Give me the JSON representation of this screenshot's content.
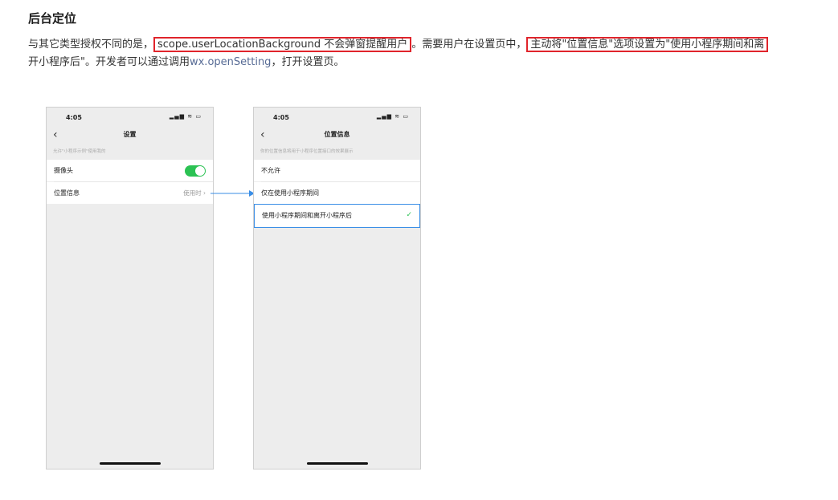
{
  "title": "后台定位",
  "para": {
    "t1": "与其它类型授权不同的是，",
    "hl1": "scope.userLocationBackground 不会弹窗提醒用户",
    "t2": "。需要用户在设置页中，",
    "hl2": "主动将\"位置信息\"选项设置为\"使用小程序期间和离",
    "t3": "开小程序后\"。开发者可以通过调用",
    "link": "wx.openSetting",
    "t4": "，打开设置页。"
  },
  "phone1": {
    "time": "4:05",
    "signal": "▂▄▆ ≋ ▭",
    "back": "‹",
    "nav_title": "设置",
    "hint": "允许\"小程序示例\"使用我的",
    "camera_label": "摄像头",
    "location_label": "位置信息",
    "location_value": "使用时 ›"
  },
  "phone2": {
    "time": "4:05",
    "signal": "▂▄▆ ≋ ▭",
    "back": "‹",
    "nav_title": "位置信息",
    "hint": "你的位置信息将用于小程序位置接口的效果展示",
    "options": [
      "不允许",
      "仅在使用小程序期间",
      "使用小程序期间和离开小程序后"
    ],
    "check": "✓"
  },
  "colors": {
    "highlight_border": "#e0242b",
    "link": "#576b95",
    "toggle_on": "#2bc253",
    "arrow": "#3a8ee6"
  },
  "icons": [
    "back-chevron-icon",
    "signal-wifi-battery-icon",
    "toggle-switch-icon",
    "checkmark-icon",
    "arrow-icon"
  ]
}
